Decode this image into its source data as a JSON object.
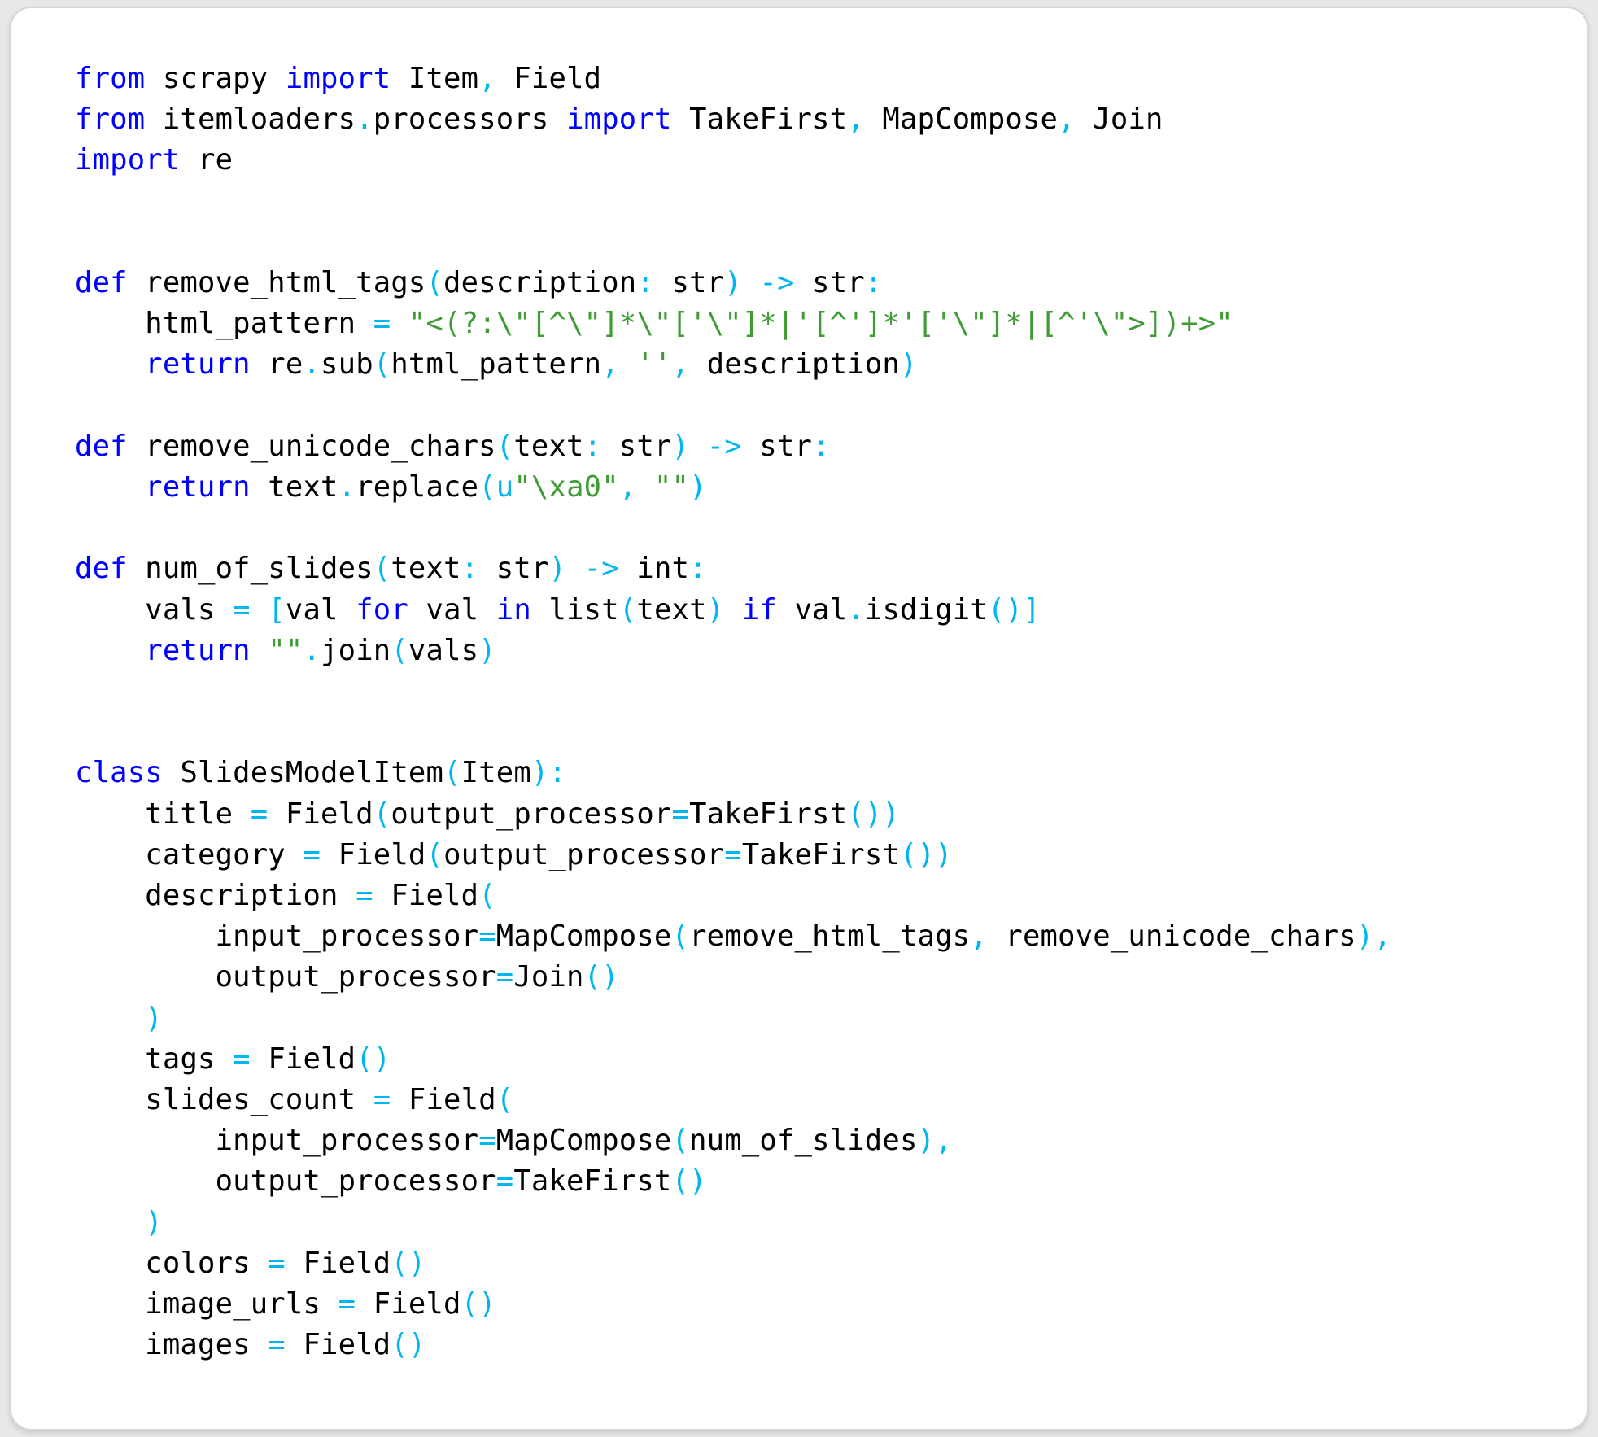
{
  "card": {
    "language": "python",
    "background": "#ffffff",
    "border_color": "#d6d6d6",
    "page_background": "#e8e8e8"
  },
  "theme": {
    "keyword_color": "#0000ff",
    "punctuation_color": "#00b6f0",
    "string_color": "#3f9c35",
    "identifier_color": "#000000"
  },
  "code": {
    "lines": [
      {
        "i": 1,
        "text": "from scrapy import Item, Field"
      },
      {
        "i": 2,
        "text": "from itemloaders.processors import TakeFirst, MapCompose, Join"
      },
      {
        "i": 3,
        "text": "import re"
      },
      {
        "i": 4,
        "text": ""
      },
      {
        "i": 5,
        "text": ""
      },
      {
        "i": 6,
        "text": "def remove_html_tags(description: str) -> str:"
      },
      {
        "i": 7,
        "text": "    html_pattern = \"<(?:\\\"[^\\\"]*\\\"['\\\"]*|'[^']*'['\\\"]*|[^'\\\">])+>\""
      },
      {
        "i": 8,
        "text": "    return re.sub(html_pattern, '', description)"
      },
      {
        "i": 9,
        "text": ""
      },
      {
        "i": 10,
        "text": "def remove_unicode_chars(text: str) -> str:"
      },
      {
        "i": 11,
        "text": "    return text.replace(u\"\\xa0\", \"\")"
      },
      {
        "i": 12,
        "text": ""
      },
      {
        "i": 13,
        "text": "def num_of_slides(text: str) -> int:"
      },
      {
        "i": 14,
        "text": "    vals = [val for val in list(text) if val.isdigit()]"
      },
      {
        "i": 15,
        "text": "    return \"\".join(vals)"
      },
      {
        "i": 16,
        "text": ""
      },
      {
        "i": 17,
        "text": ""
      },
      {
        "i": 18,
        "text": "class SlidesModelItem(Item):"
      },
      {
        "i": 19,
        "text": "    title = Field(output_processor=TakeFirst())"
      },
      {
        "i": 20,
        "text": "    category = Field(output_processor=TakeFirst())"
      },
      {
        "i": 21,
        "text": "    description = Field("
      },
      {
        "i": 22,
        "text": "        input_processor=MapCompose(remove_html_tags, remove_unicode_chars),"
      },
      {
        "i": 23,
        "text": "        output_processor=Join()"
      },
      {
        "i": 24,
        "text": "    )"
      },
      {
        "i": 25,
        "text": "    tags = Field()"
      },
      {
        "i": 26,
        "text": "    slides_count = Field("
      },
      {
        "i": 27,
        "text": "        input_processor=MapCompose(num_of_slides),"
      },
      {
        "i": 28,
        "text": "        output_processor=TakeFirst()"
      },
      {
        "i": 29,
        "text": "    )"
      },
      {
        "i": 30,
        "text": "    colors = Field()"
      },
      {
        "i": 31,
        "text": "    image_urls = Field()"
      },
      {
        "i": 32,
        "text": "    images = Field()"
      }
    ],
    "keywords": [
      "from",
      "import",
      "def",
      "return",
      "class",
      "for",
      "in",
      "if"
    ],
    "imported_names": [
      "scrapy",
      "itemloaders.processors",
      "re",
      "Item",
      "Field",
      "TakeFirst",
      "MapCompose",
      "Join"
    ],
    "functions": [
      "remove_html_tags",
      "remove_unicode_chars",
      "num_of_slides"
    ],
    "class_name": "SlidesModelItem",
    "fields": [
      "title",
      "category",
      "description",
      "tags",
      "slides_count",
      "colors",
      "image_urls",
      "images"
    ]
  }
}
